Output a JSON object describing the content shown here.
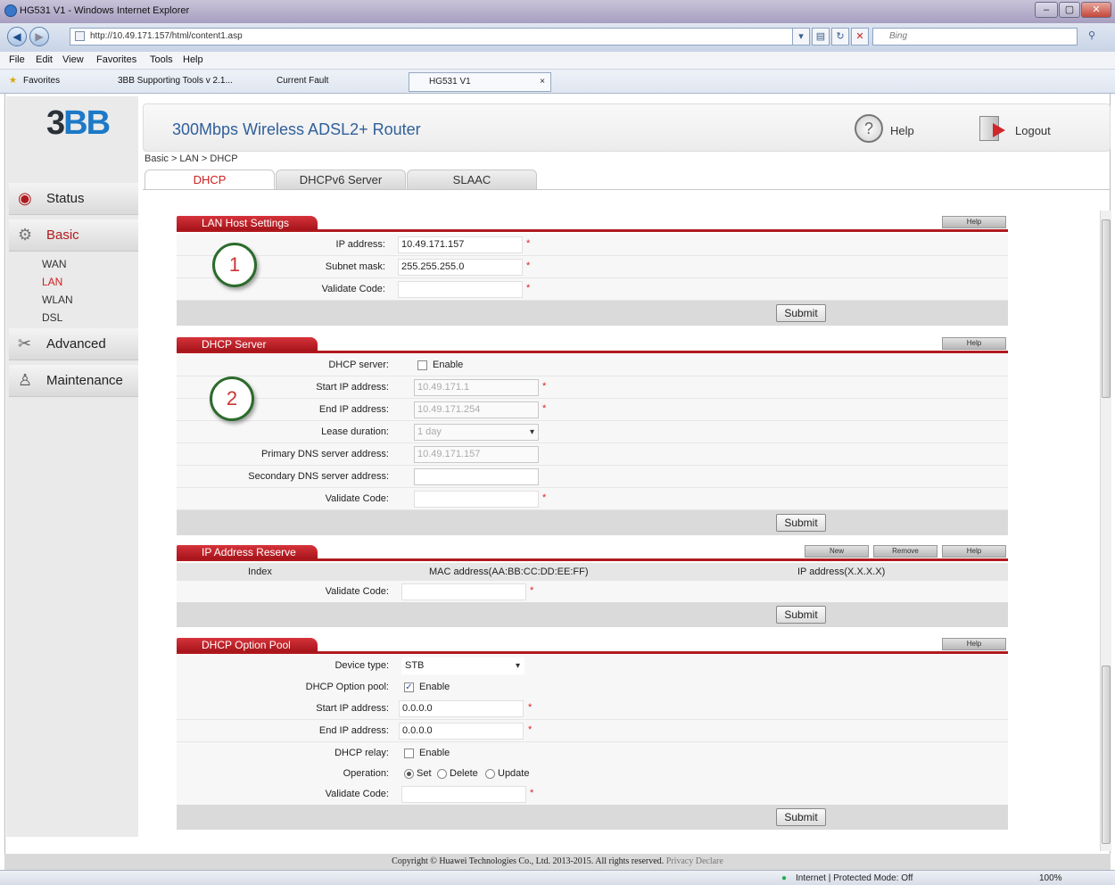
{
  "window": {
    "title": "HG531 V1 - Windows Internet Explorer"
  },
  "browser": {
    "url": "http://10.49.171.157/html/content1.asp",
    "search_placeholder": "Bing",
    "menu": [
      "File",
      "Edit",
      "View",
      "Favorites",
      "Tools",
      "Help"
    ],
    "favorites_label": "Favorites",
    "favorite_links": [
      "3BB Supporting Tools v 2.1...",
      "Current Fault"
    ],
    "tab_title": "HG531 V1",
    "tab_close": "×",
    "status_zone": "Internet | Protected Mode: Off",
    "zoom": "100%"
  },
  "router": {
    "logo_a": "3",
    "logo_b": "BB",
    "title": "300Mbps Wireless ADSL2+ Router",
    "help": "Help",
    "logout": "Logout",
    "breadcrumb": "Basic > LAN > DHCP",
    "tabs": [
      "DHCP",
      "DHCPv6 Server",
      "SLAAC"
    ],
    "nav": {
      "status": "Status",
      "basic": "Basic",
      "basic_items": [
        "WAN",
        "LAN",
        "WLAN",
        "DSL"
      ],
      "advanced": "Advanced",
      "maintenance": "Maintenance"
    }
  },
  "lan_host": {
    "title": "LAN Host Settings",
    "help": "Help",
    "ip_label": "IP address:",
    "ip_value": "10.49.171.157",
    "mask_label": "Subnet mask:",
    "mask_value": "255.255.255.0",
    "code_label": "Validate Code:",
    "code_value": "",
    "submit": "Submit",
    "marker": "1"
  },
  "dhcp_server": {
    "title": "DHCP Server",
    "help": "Help",
    "server_label": "DHCP server:",
    "enable": "Enable",
    "enabled": false,
    "start_label": "Start IP address:",
    "start_value": "10.49.171.1",
    "end_label": "End IP address:",
    "end_value": "10.49.171.254",
    "lease_label": "Lease duration:",
    "lease_value": "1 day",
    "pdns_label": "Primary DNS server address:",
    "pdns_value": "10.49.171.157",
    "sdns_label": "Secondary DNS server address:",
    "sdns_value": "",
    "code_label": "Validate Code:",
    "code_value": "",
    "submit": "Submit",
    "marker": "2"
  },
  "ip_reserve": {
    "title": "IP Address Reserve",
    "new": "New",
    "remove": "Remove",
    "help": "Help",
    "columns": [
      "Index",
      "MAC address(AA:BB:CC:DD:EE:FF)",
      "IP address(X.X.X.X)"
    ],
    "code_label": "Validate Code:",
    "submit": "Submit"
  },
  "option_pool": {
    "title": "DHCP Option Pool",
    "help": "Help",
    "device_label": "Device type:",
    "device_value": "STB",
    "pool_label": "DHCP Option pool:",
    "pool_enable": "Enable",
    "pool_checked": true,
    "start_label": "Start IP address:",
    "start_value": "0.0.0.0",
    "end_label": "End IP address:",
    "end_value": "0.0.0.0",
    "relay_label": "DHCP relay:",
    "relay_enable": "Enable",
    "relay_checked": false,
    "op_label": "Operation:",
    "op_set": "Set",
    "op_delete": "Delete",
    "op_update": "Update",
    "op_selected": "Set",
    "code_label": "Validate Code:",
    "submit": "Submit"
  },
  "footer": {
    "copyright": "Copyright © Huawei Technologies Co., Ltd. 2013-2015. All rights reserved.",
    "privacy": "Privacy Declare"
  },
  "colors": {
    "accent": "#b01a1f",
    "link": "#2f5f9a",
    "active_tab": "#cc2020"
  }
}
